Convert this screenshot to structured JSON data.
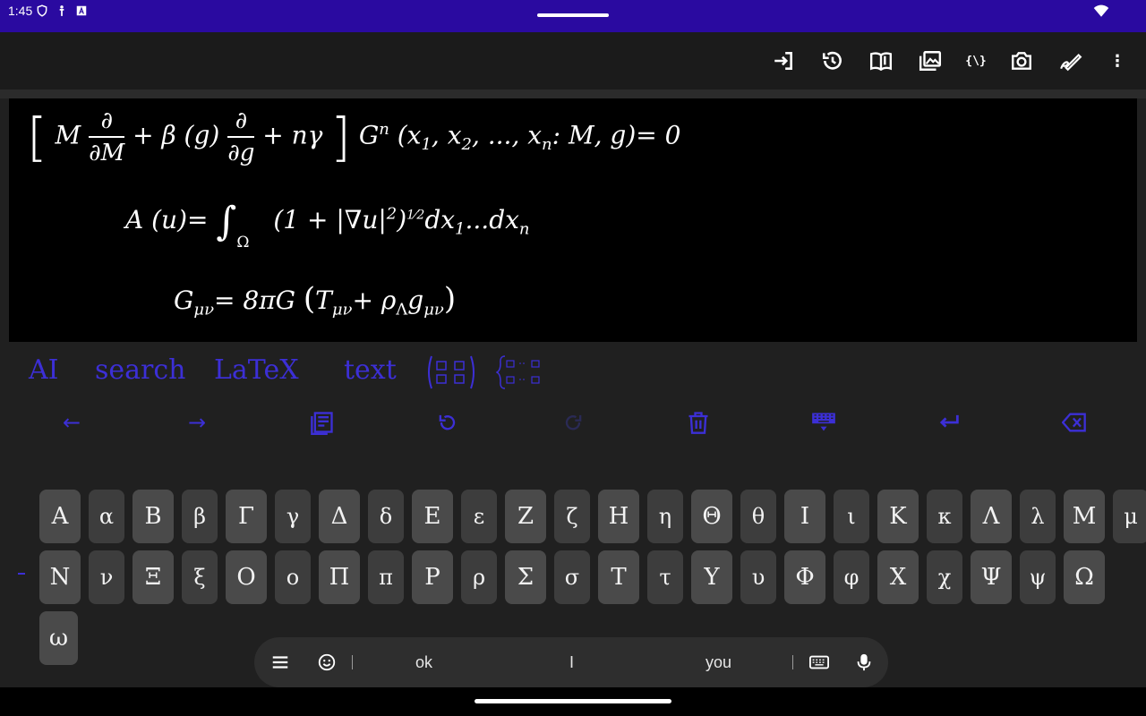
{
  "status_bar": {
    "time": "1:45",
    "icons": [
      "shield-icon",
      "accessibility-icon",
      "a-box-icon",
      "wifi-icon"
    ],
    "background": "#2a0aa0"
  },
  "toolbar": {
    "icons": [
      "login-icon",
      "history-icon",
      "book-icon",
      "gallery-icon",
      "braces-icon",
      "camera-icon",
      "handwriting-icon",
      "more-icon"
    ],
    "braces_label": "{\\}",
    "more_label": "⋮"
  },
  "formulas": {
    "line1": {
      "open": "[",
      "m": "M",
      "frac1_num": "∂",
      "frac1_den": "∂M",
      "plus1": "+ β (g)",
      "frac2_num": "∂",
      "frac2_den": "∂g",
      "plus2": "+ nγ",
      "close": "]",
      "g": "G",
      "g_sup": "n",
      "args": "(x",
      "s1": "1",
      "c1": ", x",
      "s2": "2",
      "c2": ", ..., x",
      "sn": "n",
      "tail": ": M, g)= 0"
    },
    "line2": {
      "lhs": "A (u)=",
      "integral": "∫",
      "domain": "Ω",
      "body": "(1 + |∇u|",
      "exp2": "2",
      "close": ")",
      "half": "1⁄2",
      "dx": "dx",
      "s1": "1",
      "dots": "...dx",
      "sn": "n"
    },
    "line3": {
      "g": "G",
      "g_sub": "μν",
      "eq": "= 8πG",
      "open": "(",
      "t": "T",
      "t_sub": "μν",
      "plus": "+ ρ",
      "rho_sub": "Λ",
      "gg": "g",
      "gg_sub": "μν",
      "close": ")"
    }
  },
  "modes": {
    "ai": "AI",
    "search": "search",
    "latex": "LaTeX",
    "text": "text",
    "accent": "#3c2fd6"
  },
  "actions": [
    "arrow-left-icon",
    "arrow-right-icon",
    "document-icon",
    "undo-icon",
    "redo-icon",
    "trash-icon",
    "keyboard-hide-icon",
    "enter-icon",
    "backspace-icon"
  ],
  "actions_labels": {
    "left": "←",
    "right": "→"
  },
  "keyboard": {
    "row1": [
      "Α",
      "α",
      "Β",
      "β",
      "Γ",
      "γ",
      "Δ",
      "δ",
      "Ε",
      "ε",
      "Ζ",
      "ζ",
      "Η",
      "η",
      "Θ",
      "θ",
      "Ι",
      "ι",
      "Κ",
      "κ",
      "Λ",
      "λ",
      "Μ",
      "μ"
    ],
    "row2": [
      "Ν",
      "ν",
      "Ξ",
      "ξ",
      "Ο",
      "ο",
      "Π",
      "π",
      "Ρ",
      "ρ",
      "Σ",
      "σ",
      "Τ",
      "τ",
      "Υ",
      "υ",
      "Φ",
      "φ",
      "Χ",
      "χ",
      "Ψ",
      "ψ",
      "Ω"
    ],
    "row3": [
      "ω"
    ]
  },
  "suggestions": {
    "word1": "ok",
    "word2": "I",
    "word3": "you",
    "icons": [
      "menu-icon",
      "emoji-icon",
      "keyboard-icon",
      "mic-icon"
    ]
  }
}
